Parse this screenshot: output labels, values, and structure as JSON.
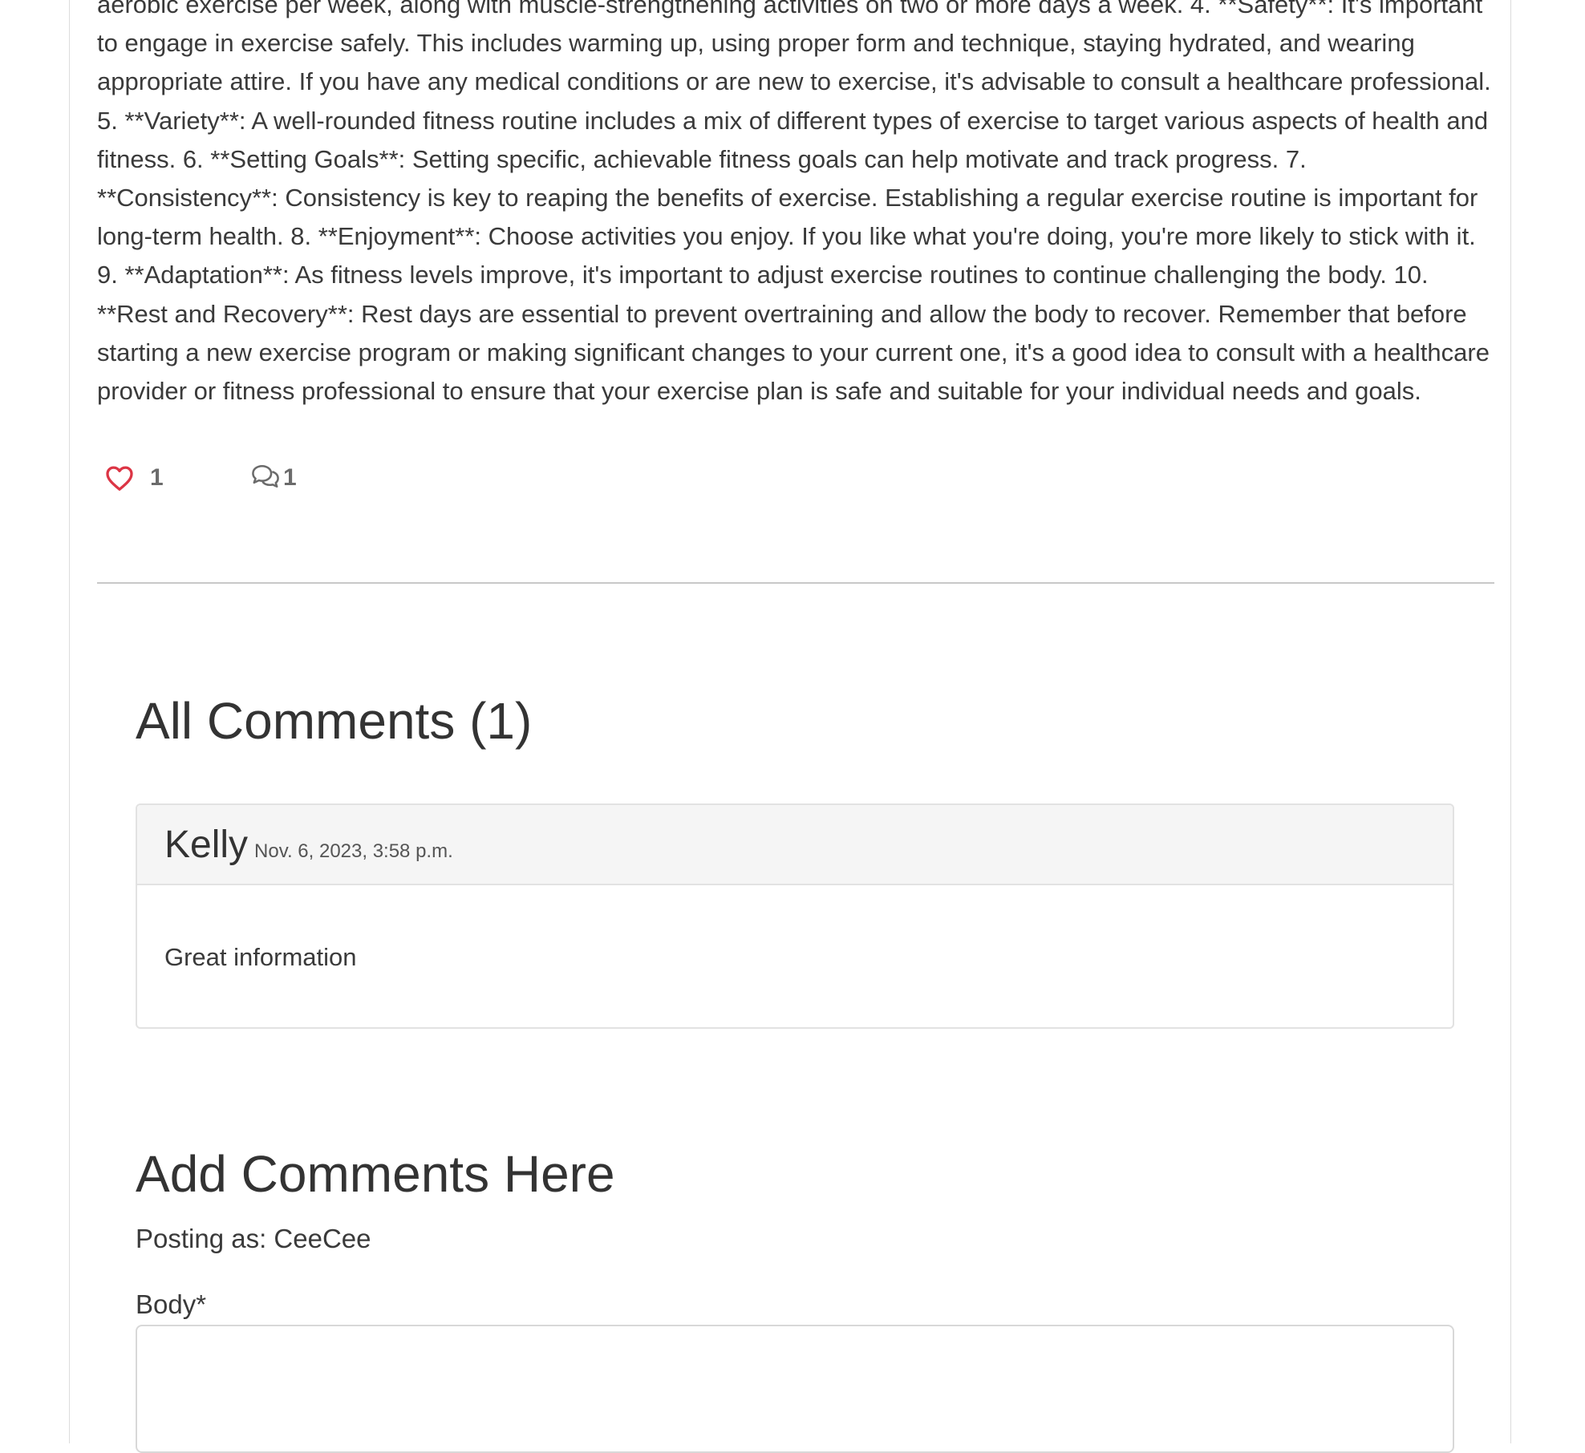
{
  "post": {
    "body_text": "aerobic exercise per week, along with muscle-strengthening activities on two or more days a week. 4. **Safety**: It's important to engage in exercise safely. This includes warming up, using proper form and technique, staying hydrated, and wearing appropriate attire. If you have any medical conditions or are new to exercise, it's advisable to consult a healthcare professional. 5. **Variety**: A well-rounded fitness routine includes a mix of different types of exercise to target various aspects of health and fitness. 6. **Setting Goals**: Setting specific, achievable fitness goals can help motivate and track progress. 7. **Consistency**: Consistency is key to reaping the benefits of exercise. Establishing a regular exercise routine is important for long-term health. 8. **Enjoyment**: Choose activities you enjoy. If you like what you're doing, you're more likely to stick with it. 9. **Adaptation**: As fitness levels improve, it's important to adjust exercise routines to continue challenging the body. 10. **Rest and Recovery**: Rest days are essential to prevent overtraining and allow the body to recover. Remember that before starting a new exercise program or making significant changes to your current one, it's a good idea to consult with a healthcare provider or fitness professional to ensure that your exercise plan is safe and suitable for your individual needs and goals.",
    "like_count": "1",
    "comment_count": "1",
    "icons": {
      "like": "heart-icon",
      "comments": "comments-icon"
    },
    "colors": {
      "heart": "#dc3545",
      "count_text": "#6b6b6b",
      "divider": "#c8c8c8"
    }
  },
  "comments_section": {
    "title": "All Comments (1)",
    "comments": [
      {
        "author": "Kelly",
        "date": "Nov. 6, 2023, 3:58 p.m.",
        "text": "Great information"
      }
    ]
  },
  "add_comment": {
    "title": "Add Comments Here",
    "posting_as": "Posting as: CeeCee",
    "body_label": "Body*",
    "body_value": ""
  }
}
